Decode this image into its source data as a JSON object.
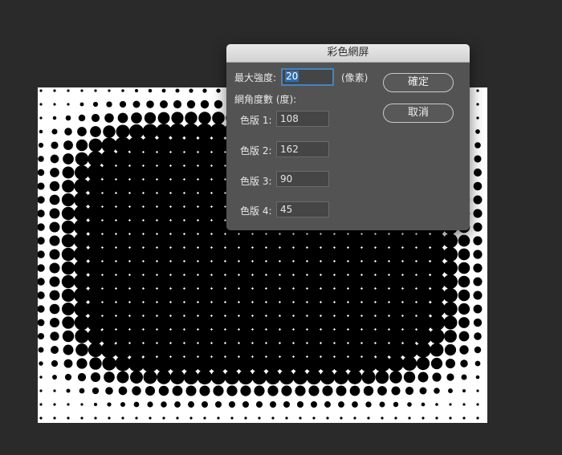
{
  "dialog": {
    "title": "彩色網屏",
    "max_radius_label": "最大強度:",
    "max_radius_value": "20",
    "unit_label": "(像素)",
    "screen_angles_label": "網角度數 (度):",
    "channels": [
      {
        "label": "色版 1:",
        "value": "108"
      },
      {
        "label": "色版 2:",
        "value": "162"
      },
      {
        "label": "色版 3:",
        "value": "90"
      },
      {
        "label": "色版 4:",
        "value": "45"
      }
    ],
    "ok_label": "確定",
    "cancel_label": "取消"
  },
  "colors": {
    "workspace_bg": "#2a2a2a",
    "canvas_bg": "#ffffff",
    "dots": "#000000",
    "dialog_bg": "#535353",
    "focus_accent": "#3f86c9"
  }
}
